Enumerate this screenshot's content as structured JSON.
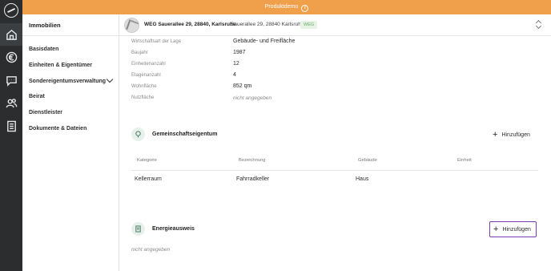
{
  "topbar": {
    "title": "Produktdemo",
    "info_icon": "info-icon"
  },
  "rail": {
    "icons": [
      "logo-icon",
      "home-icon",
      "euro-icon",
      "chat-icon",
      "people-icon",
      "document-icon"
    ]
  },
  "sidebar": {
    "title": "Immobilien",
    "items": [
      {
        "label": "Basisdaten"
      },
      {
        "label": "Einheiten & Eigentümer"
      },
      {
        "label": "Sondereigentumsverwaltung"
      },
      {
        "label": "Beirat"
      },
      {
        "label": "Dienstleister"
      },
      {
        "label": "Dokumente & Dateien"
      }
    ]
  },
  "property": {
    "name": "WEG Sauerallee 29, 28840, Karlsruhe",
    "address": "Sauerallee 29, 28840 Karlsruhe",
    "badge": "WEG"
  },
  "details": [
    {
      "label": "Wirtschaftsart der Lage",
      "value": "Gebäude- und Freifläche",
      "muted": false
    },
    {
      "label": "Baujahr",
      "value": "1987",
      "muted": false
    },
    {
      "label": "Einheitenanzahl",
      "value": "12",
      "muted": false
    },
    {
      "label": "Etagenanzahl",
      "value": "4",
      "muted": false
    },
    {
      "label": "Wohnfläche",
      "value": "852 qm",
      "muted": false
    },
    {
      "label": "Nutzfläche",
      "value": "nicht angegeben",
      "muted": true
    }
  ],
  "common_property": {
    "title": "Gemeinschaftseigentum",
    "add_label": "Hinzufügen",
    "columns": [
      "Kategorie",
      "Bezeichnung",
      "Gebäude",
      "Einheit"
    ],
    "rows": [
      [
        "Kellerraum",
        "Fahrradkeller",
        "Haus",
        ""
      ]
    ]
  },
  "energy": {
    "title": "Energieausweis",
    "add_label": "Hinzufügen",
    "empty": "nicht angegeben"
  }
}
